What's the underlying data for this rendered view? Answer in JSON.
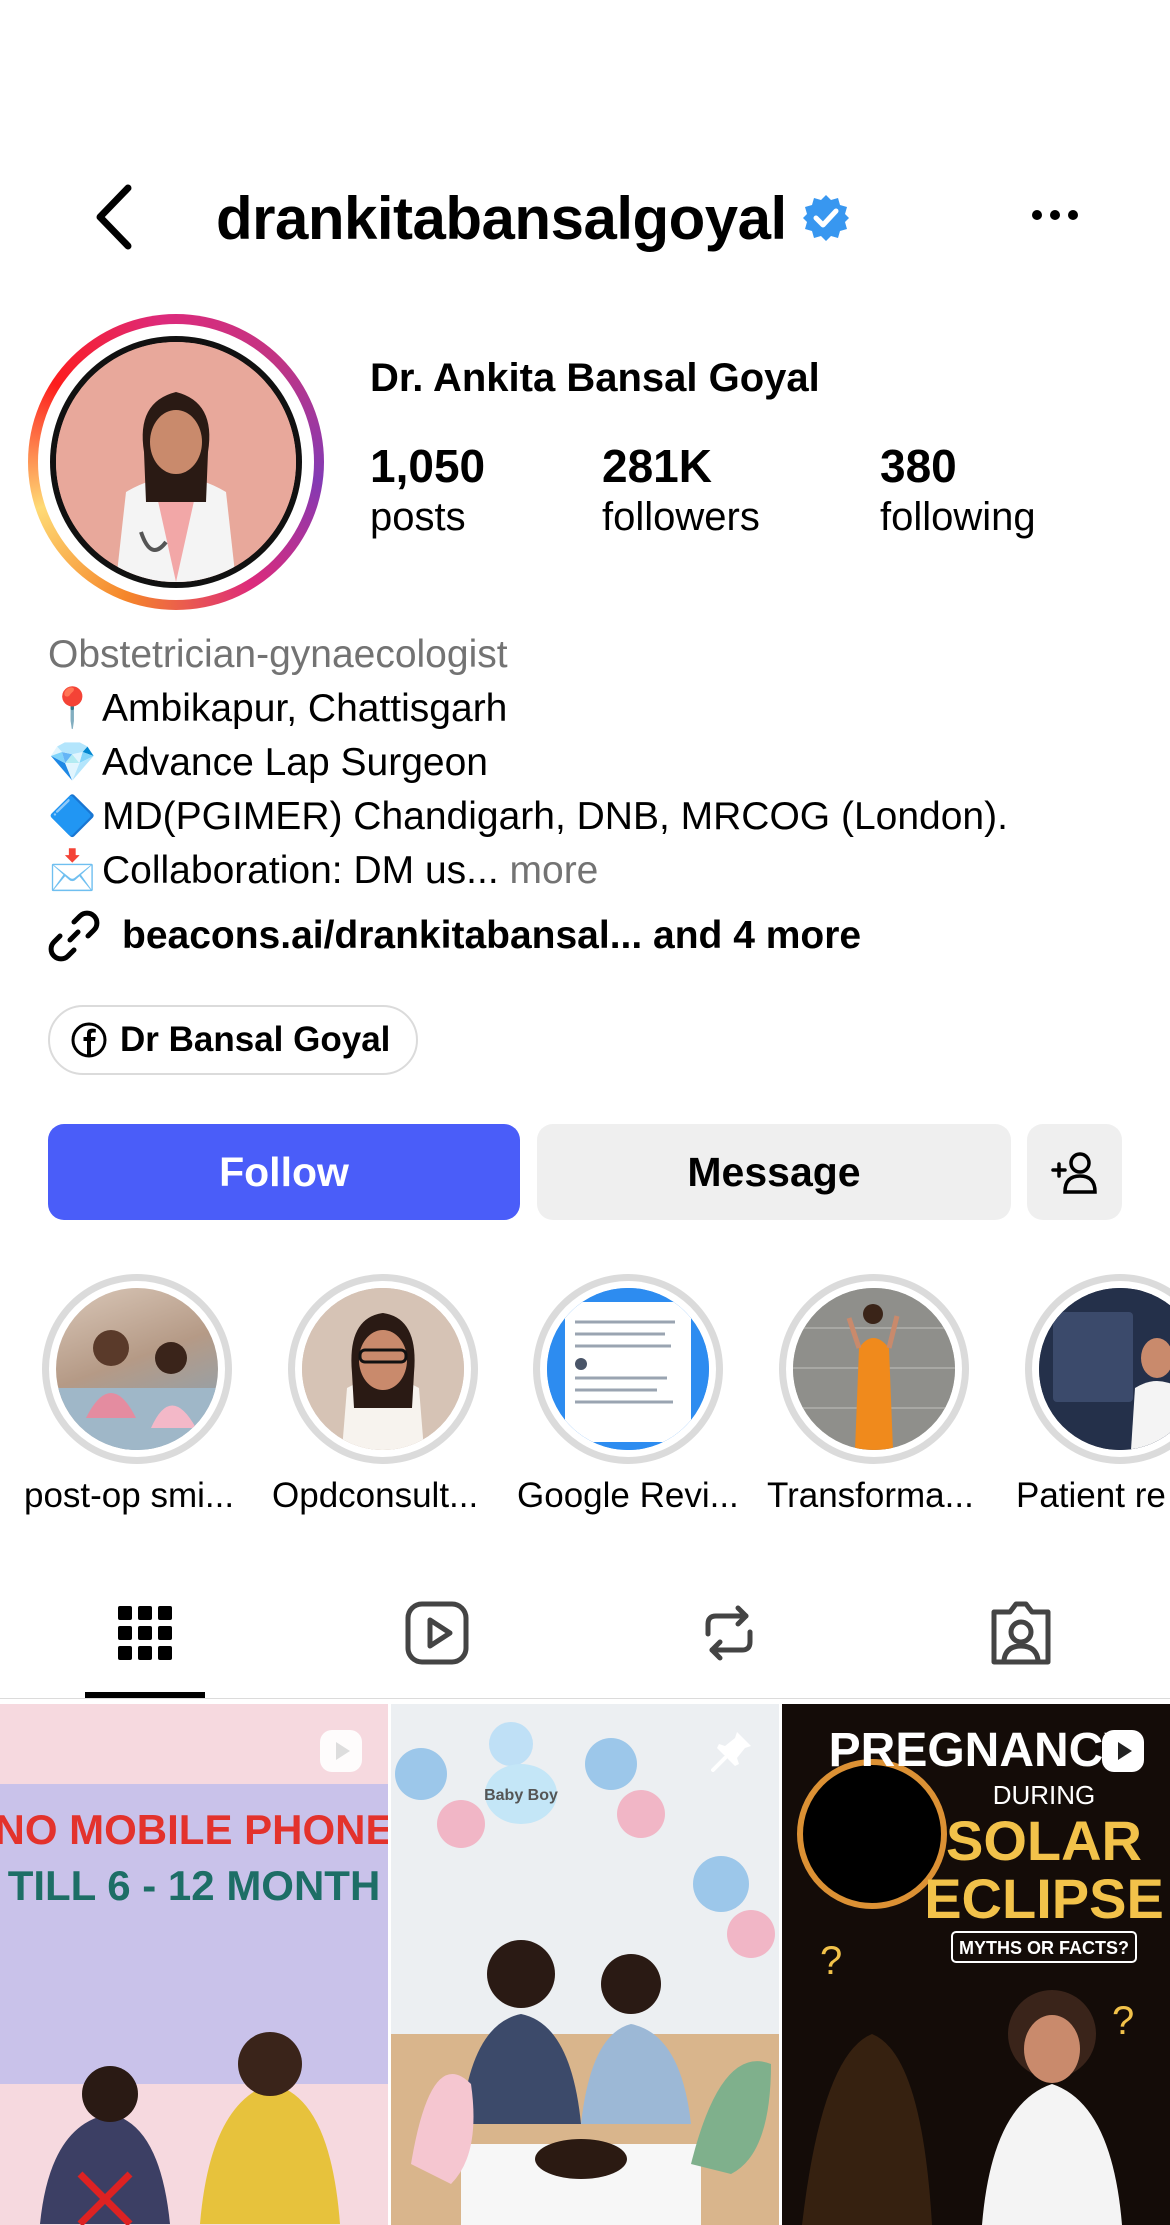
{
  "header": {
    "username": "drankitabansalgoyal",
    "verified_icon": "verified-badge-icon",
    "back_icon": "chevron-left-icon",
    "more_icon": "more-horizontal-icon"
  },
  "profile": {
    "display_name": "Dr. Ankita Bansal Goyal",
    "stats": [
      {
        "value": "1,050",
        "label": "posts"
      },
      {
        "value": "281K",
        "label": "followers"
      },
      {
        "value": "380",
        "label": "following"
      }
    ]
  },
  "bio": {
    "category": "Obstetrician-gynaecologist",
    "lines": [
      {
        "emoji": "📍",
        "text": "Ambikapur, Chattisgarh"
      },
      {
        "emoji": "💎",
        "text": "Advance Lap Surgeon"
      },
      {
        "emoji": "🔷",
        "text": "MD(PGIMER) Chandigarh, DNB, MRCOG (London)."
      },
      {
        "emoji": "📩",
        "text": "Collaboration: DM us..."
      }
    ],
    "more_label": "more",
    "link": "beacons.ai/drankitabansal...  and 4 more",
    "facebook_label": "Dr Bansal Goyal"
  },
  "actions": {
    "follow": "Follow",
    "message": "Message"
  },
  "highlights": [
    {
      "label": "post-op smi..."
    },
    {
      "label": "Opdconsult..."
    },
    {
      "label": "Google Revi..."
    },
    {
      "label": "Transforma..."
    },
    {
      "label": "Patient re"
    }
  ],
  "posts": [
    {
      "line1": "NO MOBILE PHONE",
      "line2": "TILL 6 - 12 MONTH"
    },
    {
      "balloon_text": "Baby Boy"
    },
    {
      "line1": "PREGNANCY",
      "line2": "DURING",
      "line3": "SOLAR",
      "line4": "ECLIPSE",
      "line5": "MYTHS OR FACTS?"
    }
  ],
  "colors": {
    "accent": "#4a5df9",
    "verified": "#3897f0",
    "secondary_text": "#737373"
  }
}
